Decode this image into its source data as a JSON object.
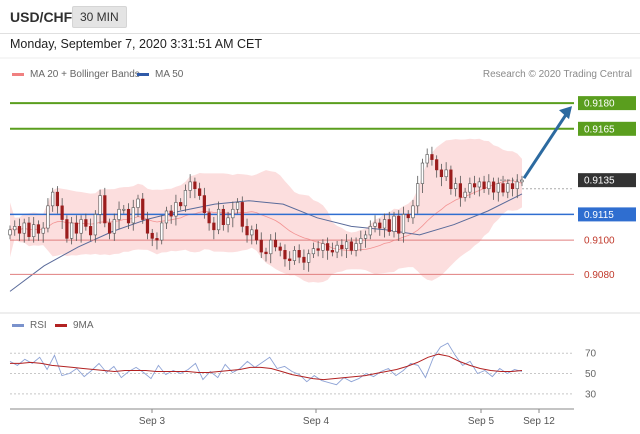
{
  "header": {
    "pair": "USD/CHF",
    "timeframe": "30 MIN",
    "datetime": "Monday, September 7, 2020 3:31:51 AM CET"
  },
  "legend": {
    "bollinger": "MA 20 + Bollinger Bands",
    "ma50": "MA 50",
    "copyright": "Research © 2020 Trading Central",
    "rsi": "RSI",
    "rsi_ma": "9MA"
  },
  "colors": {
    "green": "#5a9e1e",
    "blue_level": "#2f6ed0",
    "red_level": "#e07f7f",
    "price_box": "#333333",
    "bollinger_fill": "#fbd3d3",
    "ma20": "#f08080",
    "ma50": "#5a6b9a",
    "arrow": "#2c6aa0",
    "rsi": "#8fa4d6",
    "rsi_ma": "#b22222",
    "candle": "#9b1c1c"
  },
  "chart_data": [
    {
      "type": "candlestick",
      "title": "USD/CHF 30 MIN",
      "y_range": [
        0.9065,
        0.919
      ],
      "x_labels": [
        "Sep 3",
        "Sep 4",
        "Sep 5",
        "Sep 12"
      ],
      "levels": [
        {
          "value": 0.918,
          "label": "0.9180",
          "style": "green"
        },
        {
          "value": 0.9165,
          "label": "0.9165",
          "style": "green"
        },
        {
          "value": 0.9135,
          "label": "0.9135",
          "style": "current"
        },
        {
          "value": 0.9115,
          "label": "0.9115",
          "style": "blue"
        },
        {
          "value": 0.91,
          "label": "0.9100",
          "style": "red"
        },
        {
          "value": 0.908,
          "label": "0.9080",
          "style": "red"
        }
      ],
      "series": [
        {
          "name": "Price",
          "close": [
            0.9106,
            0.9108,
            0.9104,
            0.911,
            0.9102,
            0.9109,
            0.9104,
            0.9107,
            0.912,
            0.9128,
            0.912,
            0.9112,
            0.9101,
            0.911,
            0.9104,
            0.9112,
            0.9108,
            0.9103,
            0.9115,
            0.9126,
            0.911,
            0.9104,
            0.9112,
            0.9118,
            0.9118,
            0.911,
            0.9119,
            0.9124,
            0.9112,
            0.9104,
            0.9101,
            0.91,
            0.911,
            0.9117,
            0.9114,
            0.9122,
            0.912,
            0.9129,
            0.9134,
            0.913,
            0.9126,
            0.9116,
            0.911,
            0.9106,
            0.9118,
            0.9109,
            0.9113,
            0.9118,
            0.9122,
            0.9108,
            0.9103,
            0.9106,
            0.91,
            0.9093,
            0.9092,
            0.91,
            0.9096,
            0.9094,
            0.9089,
            0.9088,
            0.9094,
            0.909,
            0.9087,
            0.9092,
            0.9095,
            0.9094,
            0.9098,
            0.9094,
            0.9093,
            0.9097,
            0.9095,
            0.9099,
            0.9094,
            0.9098,
            0.9101,
            0.9103,
            0.9108,
            0.911,
            0.9107,
            0.9112,
            0.9105,
            0.9114,
            0.9104,
            0.9115,
            0.9113,
            0.912,
            0.9133,
            0.9145,
            0.915,
            0.9147,
            0.9141,
            0.9137,
            0.9141,
            0.913,
            0.9133,
            0.9125,
            0.9128,
            0.9133,
            0.9131,
            0.9134,
            0.913,
            0.9134,
            0.9128,
            0.9133,
            0.9128,
            0.9133,
            0.913,
            0.9134,
            0.9135
          ]
        },
        {
          "name": "MA 50",
          "values": [
            0.907,
            0.9085,
            0.9096,
            0.9105,
            0.9112,
            0.9117,
            0.9121,
            0.9123,
            0.9121,
            0.9113,
            0.9108,
            0.9106,
            0.9103,
            0.9109,
            0.9117,
            0.9127
          ]
        }
      ],
      "forecast_arrow": {
        "from": 0.9135,
        "to": 0.918
      }
    },
    {
      "type": "line",
      "title": "RSI",
      "y_ticks": [
        70,
        50,
        30
      ],
      "y_range": [
        20,
        85
      ],
      "series": [
        {
          "name": "RSI",
          "values": [
            62,
            58,
            64,
            60,
            66,
            54,
            68,
            48,
            50,
            55,
            47,
            53,
            60,
            51,
            57,
            46,
            52,
            56,
            51,
            45,
            58,
            49,
            53,
            50,
            54,
            60,
            44,
            52,
            46,
            59,
            51,
            55,
            62,
            56,
            61,
            66,
            55,
            57,
            52,
            49,
            42,
            48,
            43,
            41,
            39,
            46,
            42,
            45,
            50,
            47,
            52,
            55,
            48,
            53,
            60,
            58,
            46,
            65,
            76,
            80,
            68,
            58,
            62,
            50,
            53,
            47,
            55,
            50,
            54,
            52
          ]
        },
        {
          "name": "9MA",
          "values": [
            60,
            60,
            61,
            60,
            58,
            57,
            56,
            55,
            54,
            53,
            52,
            53,
            53,
            53,
            52,
            52,
            52,
            52,
            51,
            51,
            52,
            53,
            54,
            56,
            56,
            55,
            52,
            49,
            47,
            45,
            44,
            45,
            46,
            47,
            48,
            50,
            52,
            54,
            57,
            61,
            66,
            69,
            67,
            62,
            58,
            55,
            53,
            52,
            52,
            53
          ]
        }
      ]
    }
  ]
}
